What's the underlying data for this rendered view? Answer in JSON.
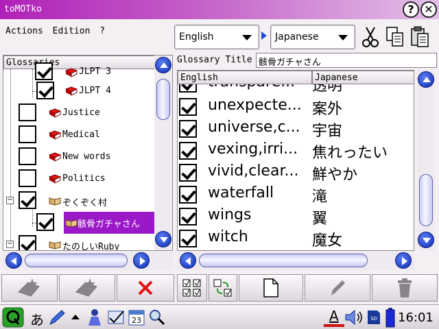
{
  "window": {
    "title": "toMOTko"
  },
  "menu": [
    "Actions",
    "Edition",
    "?"
  ],
  "languages": {
    "source": "English",
    "target": "Japanese"
  },
  "tree": {
    "header": "Glossaries",
    "items": [
      {
        "label": "JLPT 3",
        "checked": true
      },
      {
        "label": "JLPT 4",
        "checked": true
      },
      {
        "label": "Justice",
        "checked": false
      },
      {
        "label": "Medical",
        "checked": false
      },
      {
        "label": "New words",
        "checked": false
      },
      {
        "label": "Politics",
        "checked": false
      },
      {
        "label": "ぞくぞく村",
        "checked": true,
        "expander": "−"
      },
      {
        "label": "骸骨ガチャさん",
        "checked": true,
        "selected": true
      },
      {
        "label": "たのしいRuby",
        "checked": true,
        "expander": "−"
      }
    ]
  },
  "glossary": {
    "title_label": "Glossary Title",
    "title_value": "骸骨ガチャさん",
    "columns": [
      "English",
      "Japanese"
    ],
    "rows": [
      {
        "en": "transpare...",
        "ja": "透明",
        "checked": true
      },
      {
        "en": "unexpecte...",
        "ja": "案外",
        "checked": true
      },
      {
        "en": "universe,c...",
        "ja": "宇宙",
        "checked": true
      },
      {
        "en": "vexing,irri...",
        "ja": "焦れったい",
        "checked": true
      },
      {
        "en": "vivid,clear...",
        "ja": "鮮やか",
        "checked": true
      },
      {
        "en": "waterfall",
        "ja": "滝",
        "checked": true
      },
      {
        "en": "wings",
        "ja": "翼",
        "checked": true
      },
      {
        "en": "witch",
        "ja": "魔女",
        "checked": true
      }
    ]
  },
  "taskbar": {
    "input_mode": "あ",
    "keyboard": "A",
    "clock": "16:01"
  },
  "colors": {
    "accent": "#b020b8",
    "selection": "#9a18c8",
    "scroll": "#0d2db6"
  }
}
